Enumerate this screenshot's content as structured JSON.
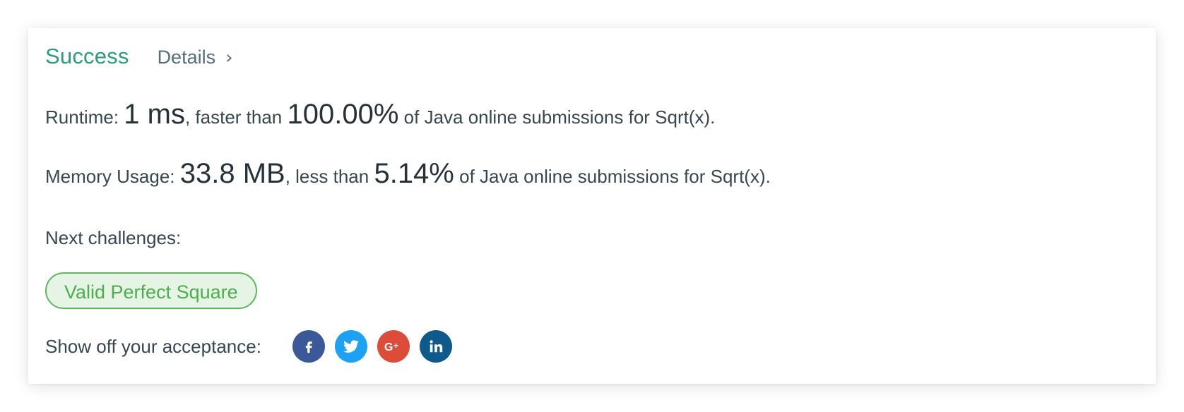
{
  "result": {
    "status": "Success",
    "details_label": "Details"
  },
  "runtime": {
    "label": "Runtime:",
    "value": "1 ms",
    "comparison": ", faster than",
    "percent": "100.00%",
    "suffix": "of Java online submissions for Sqrt(x)."
  },
  "memory": {
    "label": "Memory Usage:",
    "value": "33.8 MB",
    "comparison": ", less than",
    "percent": "5.14%",
    "suffix": "of Java online submissions for Sqrt(x)."
  },
  "next": {
    "label": "Next challenges:",
    "challenges": [
      "Valid Perfect Square"
    ]
  },
  "share": {
    "label": "Show off your acceptance:",
    "buttons": [
      {
        "icon": "facebook-icon",
        "color": "#3b5998"
      },
      {
        "icon": "twitter-icon",
        "color": "#1da1f2"
      },
      {
        "icon": "google-plus-icon",
        "color": "#dd4b39"
      },
      {
        "icon": "linkedin-icon",
        "color": "#0e5a8a"
      }
    ]
  },
  "colors": {
    "success": "#2e9a80",
    "challenge_border": "#5cb85c",
    "challenge_bg": "#e6f4e6"
  }
}
